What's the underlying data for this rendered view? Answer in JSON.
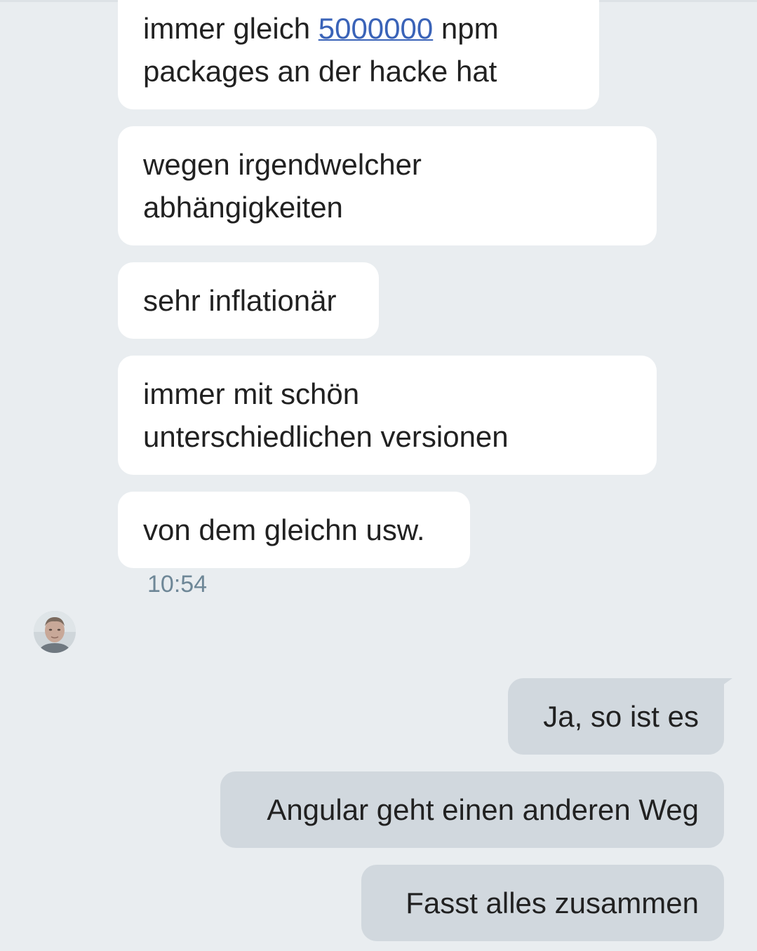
{
  "messages_in": [
    {
      "text_before": "immer gleich ",
      "link": "5000000",
      "text_after": " npm",
      "line2": "packages an der hacke hat"
    },
    {
      "line1": "wegen irgendwelcher",
      "line2": "abhängigkeiten"
    },
    {
      "text": "sehr inflationär"
    },
    {
      "line1": "immer mit schön",
      "line2": "unterschiedlichen versionen"
    },
    {
      "text": "von dem gleichn usw."
    }
  ],
  "timestamp": "10:54",
  "avatar": {
    "icon": "user-avatar-icon"
  },
  "messages_out": [
    {
      "text": "Ja, so ist es"
    },
    {
      "text": "Angular geht einen anderen Weg"
    },
    {
      "text": "Fasst alles zusammen"
    }
  ],
  "colors": {
    "background": "#e9edf0",
    "incoming_bubble": "#ffffff",
    "outgoing_bubble": "#d1d8de",
    "link": "#3a63b8",
    "timestamp": "#6e8797"
  }
}
